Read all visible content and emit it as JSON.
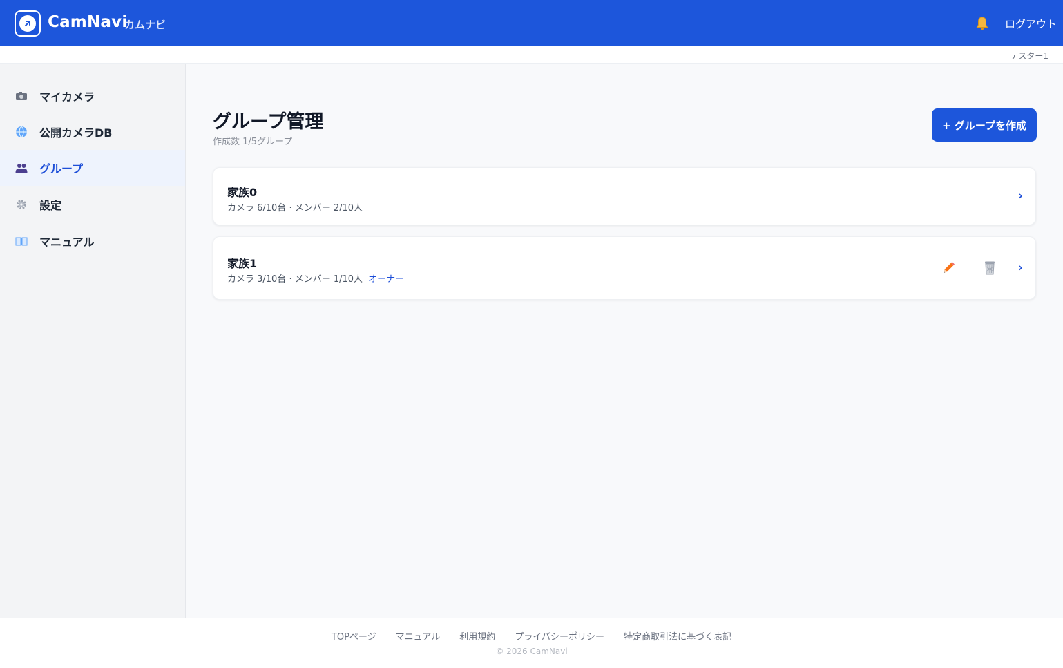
{
  "header": {
    "brand": "CamNavi",
    "brand_sub": "カムナビ",
    "logout_label": "ログアウト",
    "username": "テスター1"
  },
  "sidebar": {
    "items": [
      {
        "label": "マイカメラ",
        "icon": "camera-icon"
      },
      {
        "label": "公開カメラDB",
        "icon": "globe-icon"
      },
      {
        "label": "グループ",
        "icon": "people-icon",
        "active": true
      },
      {
        "label": "設定",
        "icon": "gear-icon"
      },
      {
        "label": "マニュアル",
        "icon": "book-icon"
      }
    ]
  },
  "main": {
    "title": "グループ管理",
    "subtitle": "作成数 1/5グループ",
    "create_button": "+ グループを作成",
    "groups": [
      {
        "name": "家族0",
        "meta": "カメラ 6/10台 · メンバー 2/10人",
        "owner_label": ""
      },
      {
        "name": "家族1",
        "meta": "カメラ 3/10台 · メンバー 1/10人",
        "owner_label": "オーナー"
      }
    ],
    "chevron": "›"
  },
  "footer": {
    "links": [
      "TOPページ",
      "マニュアル",
      "利用規約",
      "プライバシーポリシー",
      "特定商取引法に基づく表記"
    ],
    "copyright": "© 2026 CamNavi"
  },
  "colors": {
    "primary": "#1d56db",
    "active_bg": "#eef3fd",
    "edit_icon": "#f97316",
    "trash_icon": "#9ca3af"
  }
}
